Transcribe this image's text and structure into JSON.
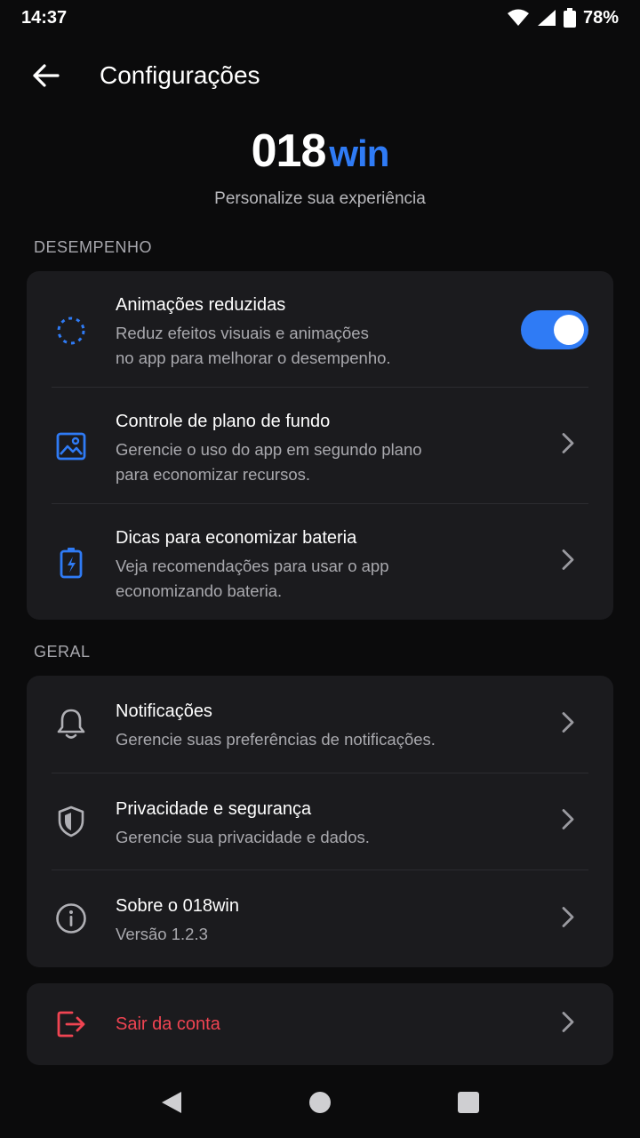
{
  "status_bar": {
    "time": "14:37",
    "battery": "78%"
  },
  "app_bar": {
    "title": "Configurações"
  },
  "brand": {
    "logo_part1": "018",
    "logo_part2": "win",
    "subtitle": "Personalize sua experiência"
  },
  "sections": {
    "performance": {
      "label": "DESEMPENHO",
      "items": [
        {
          "title": "Animações reduzidas",
          "desc1": "Reduz efeitos visuais e animações",
          "desc2": "no app para melhorar o desempenho.",
          "toggle_on": true
        },
        {
          "title": "Controle de plano de fundo",
          "desc1": "Gerencie o uso do app em segundo plano",
          "desc2": "para economizar recursos."
        },
        {
          "title": "Dicas para economizar bateria",
          "desc1": "Veja recomendações para usar o app",
          "desc2": "economizando bateria."
        }
      ]
    },
    "general": {
      "label": "GERAL",
      "items": [
        {
          "title": "Notificações",
          "desc": "Gerencie suas preferências de notificações."
        },
        {
          "title": "Privacidade e segurança",
          "desc": "Gerencie sua privacidade e dados."
        },
        {
          "title": "Sobre o 018win",
          "desc": "Versão 1.2.3"
        }
      ]
    }
  },
  "logout": {
    "label": "Sair da conta"
  },
  "colors": {
    "accent": "#2f7bf5",
    "danger": "#f04452",
    "card": "#1b1b1e",
    "background": "#0b0b0c"
  }
}
